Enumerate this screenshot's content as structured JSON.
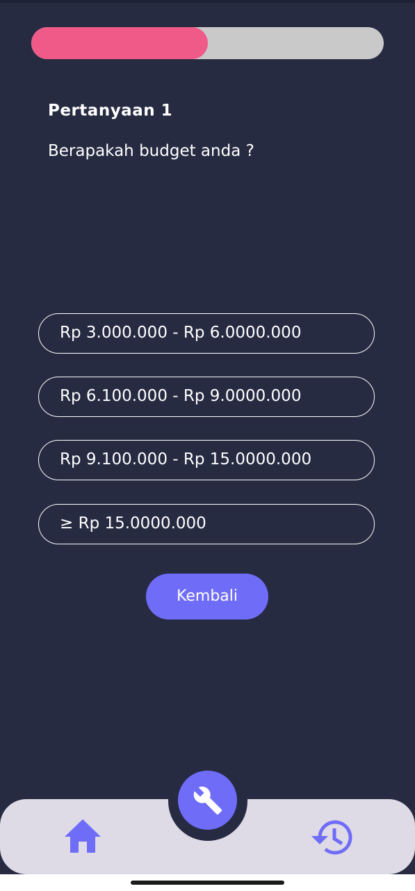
{
  "progress": {
    "fraction": 0.5
  },
  "question": {
    "title": "Pertanyaan 1",
    "text": "Berapakah budget anda ?"
  },
  "options": [
    {
      "label": "Rp 3.000.000 - Rp 6.0000.000"
    },
    {
      "label": "Rp 6.100.000 - Rp 9.0000.000"
    },
    {
      "label": "Rp 9.100.000 - Rp 15.0000.000"
    },
    {
      "label": "≥ Rp 15.0000.000"
    }
  ],
  "back_button": {
    "label": "Kembali"
  },
  "navbar": {
    "items": [
      {
        "icon": "home-icon"
      },
      {
        "icon": "wrench-icon"
      },
      {
        "icon": "history-icon"
      }
    ]
  },
  "colors": {
    "background": "#262b42",
    "accent": "#6f6cf8",
    "progress_fill": "#ef5a88",
    "progress_track": "#c9c9c9",
    "navbar": "#dedae6"
  }
}
